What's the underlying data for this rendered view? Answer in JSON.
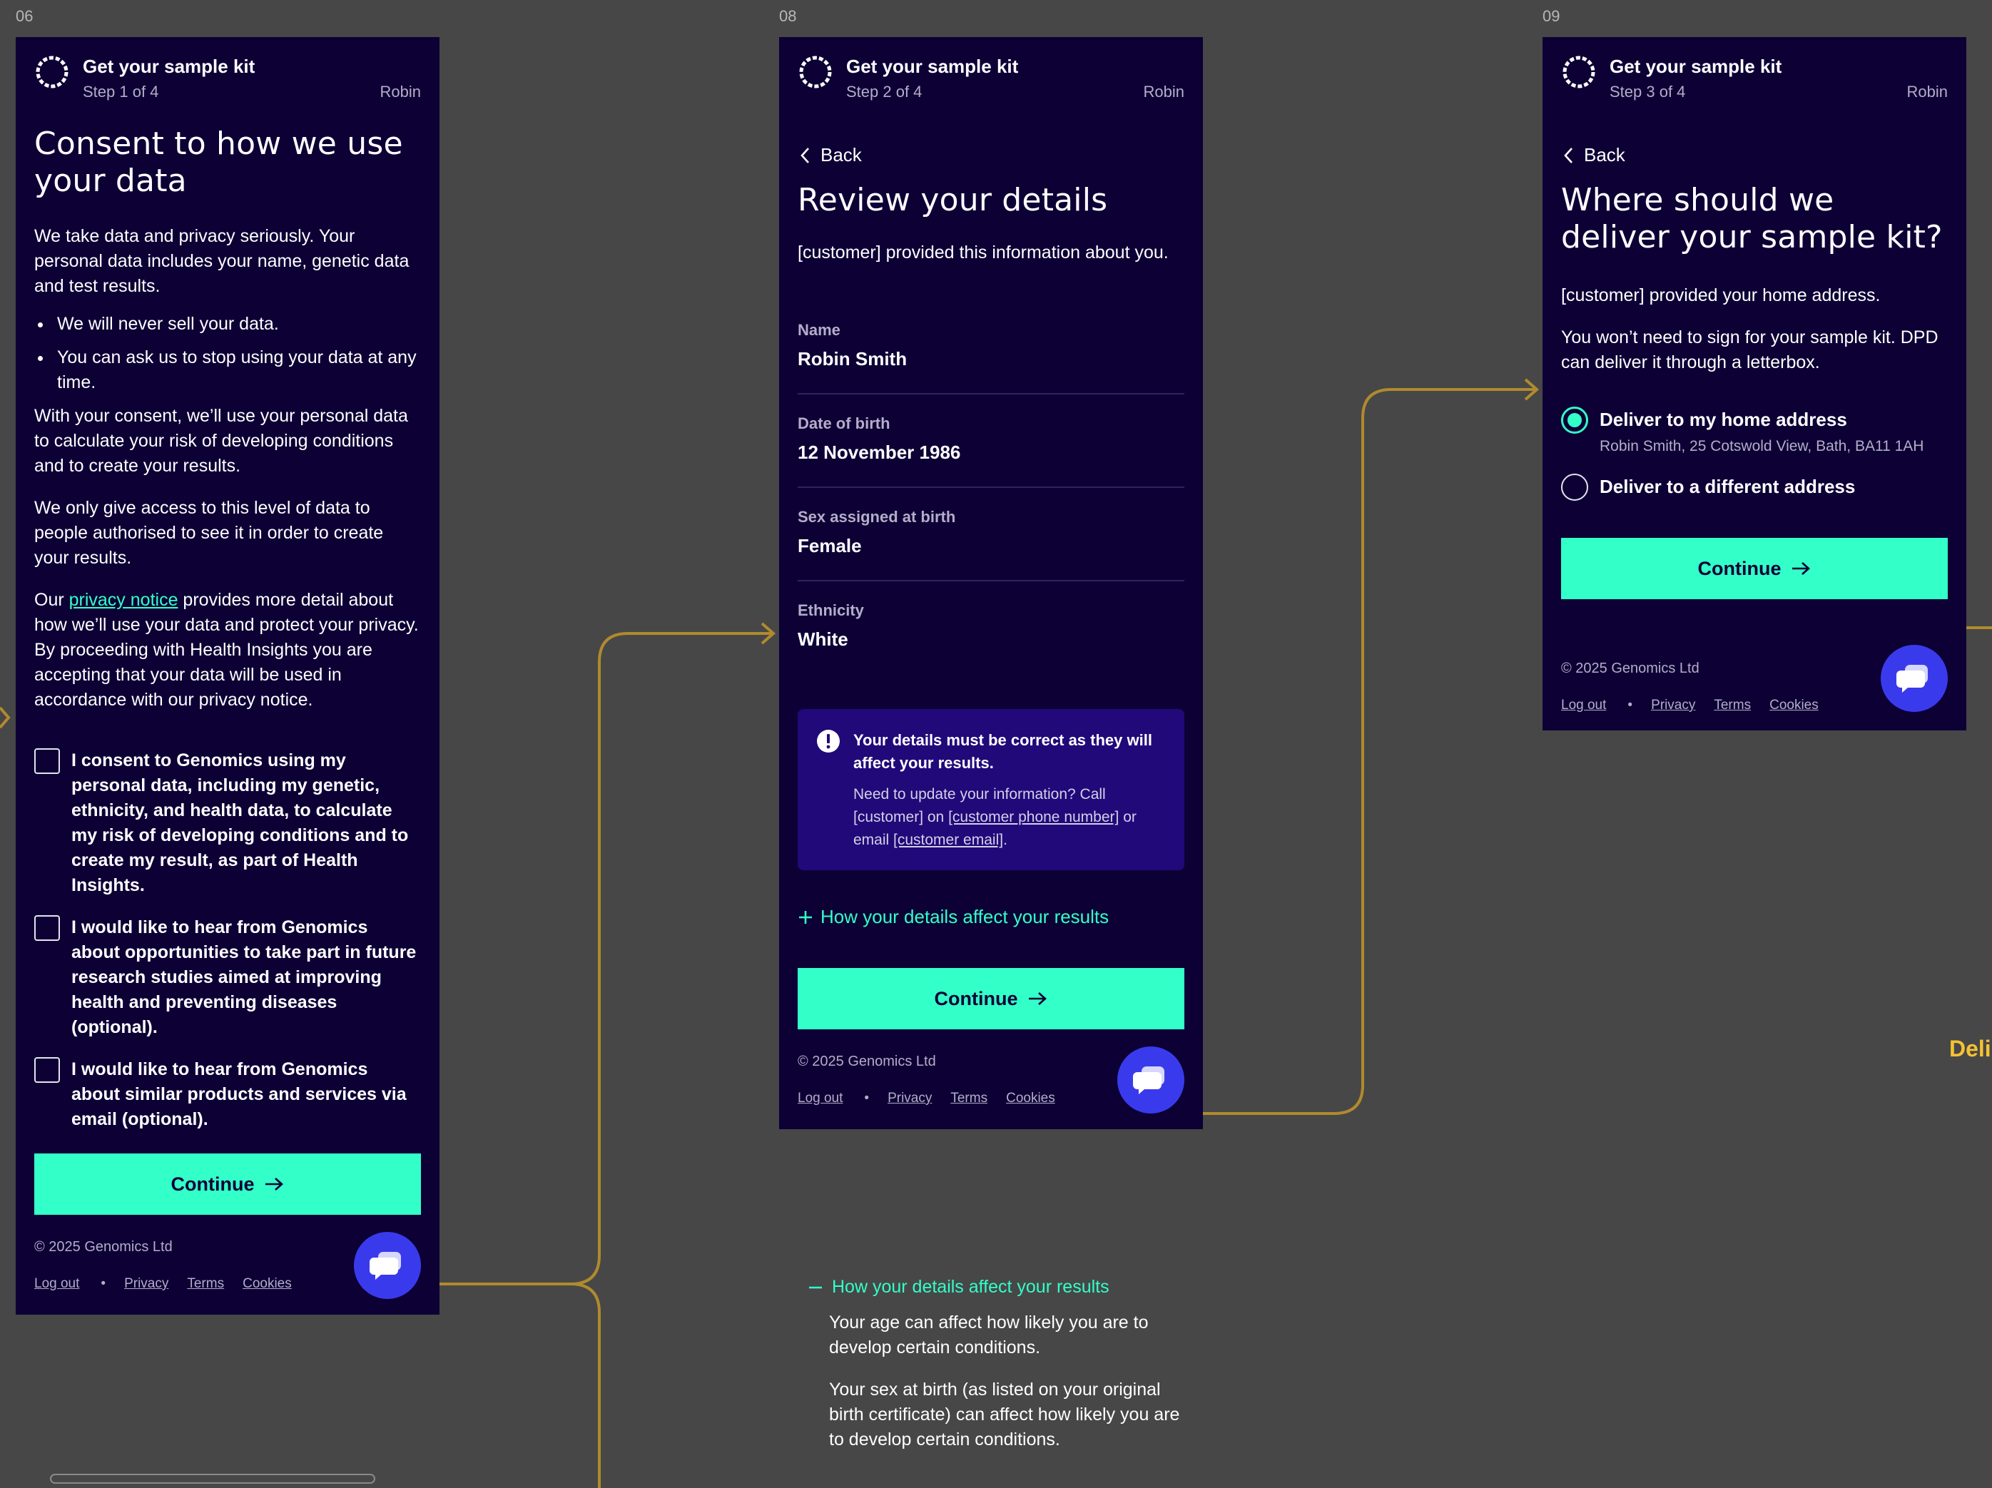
{
  "frames": [
    {
      "label": "06"
    },
    {
      "label": "08"
    },
    {
      "label": "09"
    }
  ],
  "header": {
    "title": "Get your sample kit",
    "steps": [
      "Step 1 of 4",
      "Step 2 of 4",
      "Step 3 of 4"
    ],
    "user": "Robin"
  },
  "back_label": "Back",
  "continue_label": "Continue",
  "footer": {
    "copyright": "© 2025 Genomics Ltd",
    "logout": "Log out",
    "dot": "•",
    "privacy": "Privacy",
    "terms": "Terms",
    "cookies": "Cookies"
  },
  "consent": {
    "title": "Consent to how we use your data",
    "intro": "We take data and privacy seriously. Your personal data includes your name, genetic data and test results.",
    "bullets": [
      "We will never sell your data.",
      "You can ask us to stop using your data at any time."
    ],
    "para2": "With your consent, we’ll use your personal data to calculate your risk of developing conditions and to create your results.",
    "para3": "We only give access to this level of data to people authorised to see it in order to create your results.",
    "para4_pre": "Our ",
    "para4_link": "privacy notice",
    "para4_post": " provides more detail about how we’ll use your data and protect your privacy. By proceeding with Health Insights you are accepting that your data will be used in accordance with our privacy notice.",
    "checkboxes": [
      {
        "label": "I consent to Genomics using my personal data, including my genetic, ethnicity, and health data, to calculate my risk of developing conditions and to create my result, as part of Health Insights.",
        "checked": false
      },
      {
        "label": "I would like to hear from Genomics about opportunities to take part in future research studies aimed at improving health and preventing diseases (optional).",
        "checked": false
      },
      {
        "label": "I would like to hear from Genomics about similar products and services via email (optional).",
        "checked": false
      }
    ]
  },
  "review": {
    "title": "Review your details",
    "intro": "[customer] provided this information about you.",
    "fields": [
      {
        "label": "Name",
        "value": "Robin Smith"
      },
      {
        "label": "Date of birth",
        "value": "12 November 1986"
      },
      {
        "label": "Sex assigned at birth",
        "value": "Female"
      },
      {
        "label": "Ethnicity",
        "value": "White"
      }
    ],
    "notice_bold": "Your details must be correct as they will affect your results.",
    "notice_pre": "Need to update your information? Call [customer] on ",
    "notice_phone": "[customer phone number]",
    "notice_mid": " or email ",
    "notice_email": "[customer email]",
    "notice_end": ".",
    "expander": "How your details affect your results"
  },
  "expanded": {
    "title": "How your details affect your results",
    "paras": [
      "Your age can affect how likely you are to develop certain conditions.",
      "Your sex at birth (as listed on your original birth certificate) can affect how likely you are to develop certain conditions."
    ]
  },
  "deliver": {
    "title": "Where should we deliver your sample kit?",
    "p1": "[customer] provided your home address.",
    "p2": "You won’t need to sign for your sample kit. DPD can deliver it through a letterbox.",
    "options": [
      {
        "label": "Deliver to my home address",
        "sub": "Robin Smith, 25 Cotswold View, Bath, BA11 1AH",
        "selected": true
      },
      {
        "label": "Deliver to a different address",
        "sub": "",
        "selected": false
      }
    ]
  },
  "offscreen_label": "Deli",
  "colors": {
    "canvas": "#474747",
    "screen_bg": "#0d0035",
    "accent": "#33ffc8",
    "connector": "#b08a2e",
    "chat": "#3a3aed",
    "notice_bg": "#21097a"
  }
}
